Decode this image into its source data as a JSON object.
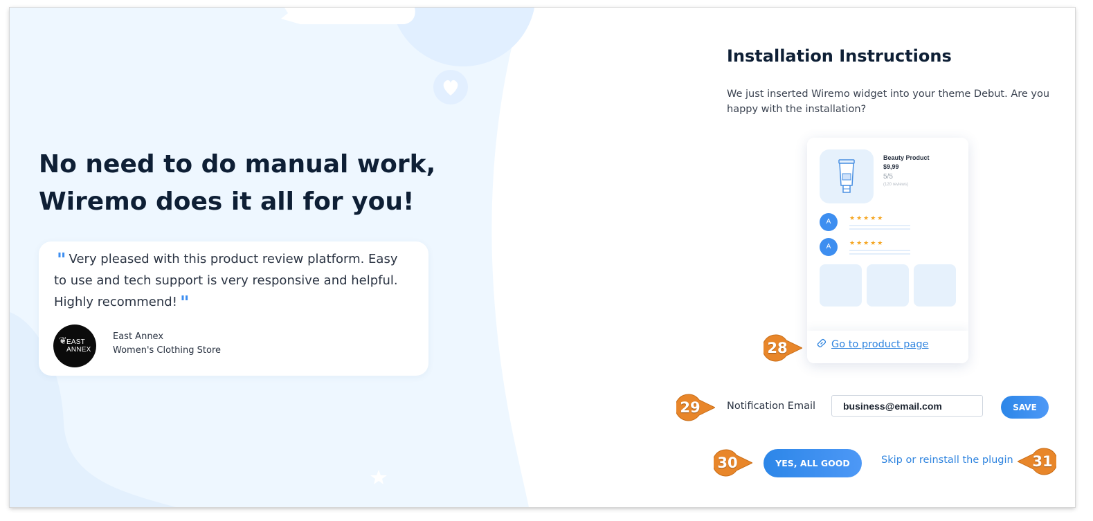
{
  "left_panel": {
    "headline_line1": "No need to do manual work,",
    "headline_line2": "Wiremo does it all for you!",
    "testimonial": {
      "text": "Very pleased with this product review platform. Easy to use and tech support is very responsive and helpful. Highly recommend!",
      "quote_open": "\"",
      "quote_close": "\"",
      "logo_line1": "EAST",
      "logo_line2": "ANNEX",
      "author_name": "East Annex",
      "author_store": "Women's Clothing Store"
    }
  },
  "right_panel": {
    "title": "Installation Instructions",
    "description": "We just inserted Wiremo widget into your theme Debut. Are you happy with the installation?",
    "preview": {
      "product_name": "Beauty Product",
      "product_price": "$9,99",
      "product_rating": "5/5",
      "product_reviews": "(120 reviews)",
      "reviews": [
        {
          "avatar": "A",
          "stars": "★★★★★"
        },
        {
          "avatar": "A",
          "stars": "★★★★★"
        }
      ],
      "link_label": "Go to product page"
    },
    "notification_email": {
      "label": "Notification Email",
      "value": "business@email.com"
    },
    "save_label": "SAVE",
    "confirm_label": "YES, ALL GOOD",
    "skip_label": "Skip or reinstall the plugin"
  },
  "callouts": [
    "28",
    "29",
    "30",
    "31"
  ],
  "colors": {
    "accent": "#3d8ef0",
    "callout": "#e8862a",
    "heading": "#0e1f35",
    "background_tint": "#edf6ff"
  }
}
